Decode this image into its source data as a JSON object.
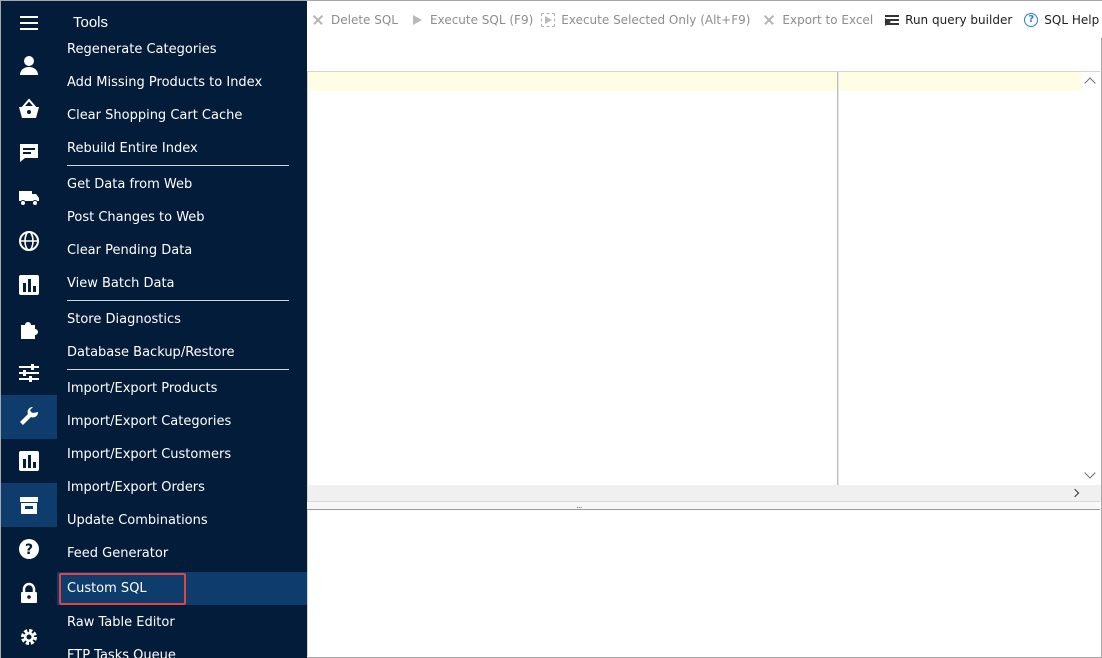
{
  "toolbar": {
    "delete_sql": "Delete SQL",
    "execute_sql": "Execute SQL (F9)",
    "execute_selected": "Execute Selected Only (Alt+F9)",
    "export_excel": "Export to Excel",
    "run_query_builder": "Run query builder",
    "sql_help": "SQL Help",
    "hash": "#"
  },
  "menu": {
    "title": "Tools",
    "items": [
      {
        "label": "Regenerate Categories"
      },
      {
        "label": "Add Missing Products to Index"
      },
      {
        "label": "Clear Shopping Cart Cache"
      },
      {
        "label": "Rebuild Entire Index"
      },
      {
        "label": "Get Data from Web"
      },
      {
        "label": "Post Changes to Web"
      },
      {
        "label": "Clear Pending Data"
      },
      {
        "label": "View Batch Data"
      },
      {
        "label": "Store Diagnostics"
      },
      {
        "label": "Database Backup/Restore"
      },
      {
        "label": "Import/Export Products"
      },
      {
        "label": "Import/Export Categories"
      },
      {
        "label": "Import/Export Customers"
      },
      {
        "label": "Import/Export Orders"
      },
      {
        "label": "Update Combinations"
      },
      {
        "label": "Feed Generator"
      },
      {
        "label": "Custom SQL"
      },
      {
        "label": "Raw Table Editor"
      },
      {
        "label": "FTP Tasks Queue"
      }
    ]
  },
  "colors": {
    "sidebar_bg": "#031c3a",
    "sidebar_selected": "#0e3c6d",
    "highlight_border": "#e0463f",
    "editor_current_line": "#fffde4",
    "help_blue": "#2b7dd6"
  }
}
